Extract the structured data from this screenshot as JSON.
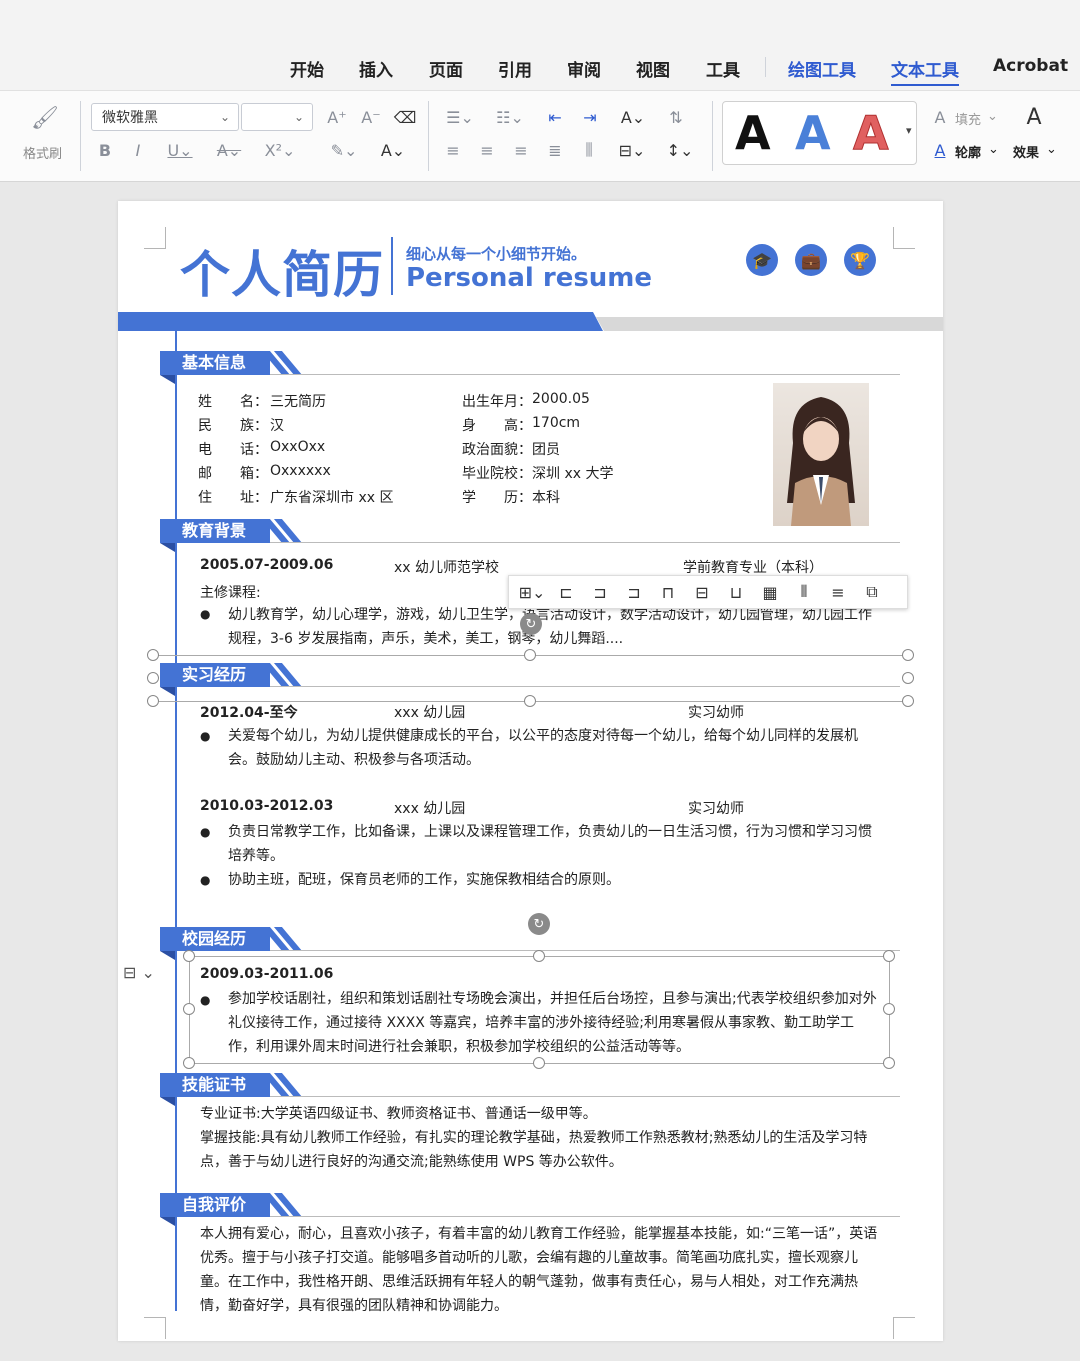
{
  "menu": {
    "tabs": [
      {
        "label": "开始"
      },
      {
        "label": "插入"
      },
      {
        "label": "页面"
      },
      {
        "label": "引用"
      },
      {
        "label": "审阅"
      },
      {
        "label": "视图"
      },
      {
        "label": "工具"
      },
      {
        "label": "绘图工具"
      },
      {
        "label": "文本工具"
      },
      {
        "label": "Acrobat"
      }
    ],
    "active_tab": "文本工具"
  },
  "ribbon": {
    "format_painter": "格式刷",
    "font_name": "微软雅黑",
    "font_size": "",
    "fill_label": "填充",
    "outline_label": "轮廓",
    "effect_label": "效果",
    "style_preview_letter": "A",
    "accent_color": "#2f5bd0"
  },
  "resume": {
    "title_cn": "个人简历",
    "slogan": "细心从每一个小细节开始。",
    "title_en": "Personal resume",
    "header_icons": [
      "graduation-cap-icon",
      "briefcase-icon",
      "trophy-icon"
    ],
    "brand_color": "#4473d4",
    "sections": {
      "basic": "基本信息",
      "education": "教育背景",
      "internship": "实习经历",
      "campus": "校园经历",
      "skills": "技能证书",
      "self_eval": "自我评价"
    },
    "basic_info": {
      "left": [
        {
          "k1": "姓",
          "k2": "名：",
          "v": "三无简历"
        },
        {
          "k1": "民",
          "k2": "族：",
          "v": "汉"
        },
        {
          "k1": "电",
          "k2": "话：",
          "v": "OxxOxx"
        },
        {
          "k1": "邮",
          "k2": "箱：",
          "v": "Oxxxxxx"
        },
        {
          "k1": "住",
          "k2": "址：",
          "v": "广东省深圳市 xx 区"
        }
      ],
      "right": [
        {
          "k": "出生年月：",
          "v": "2000.05"
        },
        {
          "k": "身　　高：",
          "v": "170cm"
        },
        {
          "k": "政治面貌：",
          "v": "团员"
        },
        {
          "k": "毕业院校：",
          "v": "深圳 xx 大学"
        },
        {
          "k": "学　　历：",
          "v": "本科"
        }
      ]
    },
    "education": {
      "period": "2005.07-2009.06",
      "school": "xx 幼儿师范学校",
      "major": "学前教育专业（本科）",
      "courses_label": "主修课程:",
      "courses": "幼儿教育学，幼儿心理学，游戏，幼儿卫生学，语言活动设计，数学活动设计，幼儿园管理，幼儿园工作规程，3-6 岁发展指南，声乐，美术，美工，钢琴，幼儿舞蹈...."
    },
    "internship": [
      {
        "period": "2012.04-至今",
        "org": "xxx 幼儿园",
        "role": "实习幼师",
        "items": [
          "关爱每个幼儿，为幼儿提供健康成长的平台，以公平的态度对待每一个幼儿，给每个幼儿同样的发展机会。鼓励幼儿主动、积极参与各项活动。"
        ]
      },
      {
        "period": "2010.03-2012.03",
        "org": "xxx 幼儿园",
        "role": "实习幼师",
        "items": [
          "负责日常教学工作，比如备课，上课以及课程管理工作，负责幼儿的一日生活习惯，行为习惯和学习习惯培养等。",
          "协助主班，配班，保育员老师的工作，实施保教相结合的原则。"
        ]
      }
    ],
    "campus": {
      "period": "2009.03-2011.06",
      "item": "参加学校话剧社，组织和策划话剧社专场晚会演出，并担任后台场控，且参与演出;代表学校组织参加对外礼仪接待工作，通过接待 XXXX 等嘉宾，培养丰富的涉外接待经验;利用寒暑假从事家教、勤工助学工作，利用课外周末时间进行社会兼职，积极参加学校组织的公益活动等等。"
    },
    "skills": {
      "line1": "专业证书:大学英语四级证书、教师资格证书、普通话一级甲等。",
      "line2": "掌握技能:具有幼儿教师工作经验，有扎实的理论教学基础，热爱教师工作熟悉教材;熟悉幼儿的生活及学习特点，善于与幼儿进行良好的沟通交流;能熟练使用 WPS 等办公软件。"
    },
    "self_eval": "本人拥有爱心，耐心，且喜欢小孩子，有着丰富的幼儿教育工作经验，能掌握基本技能，如:“三笔一话”，英语优秀。擅于与小孩子打交道。能够唱多首动听的儿歌，会编有趣的儿童故事。简笔画功底扎实，擅长观察儿童。在工作中，我性格开朗、思维活跃拥有年轻人的朝气蓬勃，做事有责任心，易与人相处，对工作充满热情，勤奋好学，具有很强的团队精神和协调能力。"
  }
}
